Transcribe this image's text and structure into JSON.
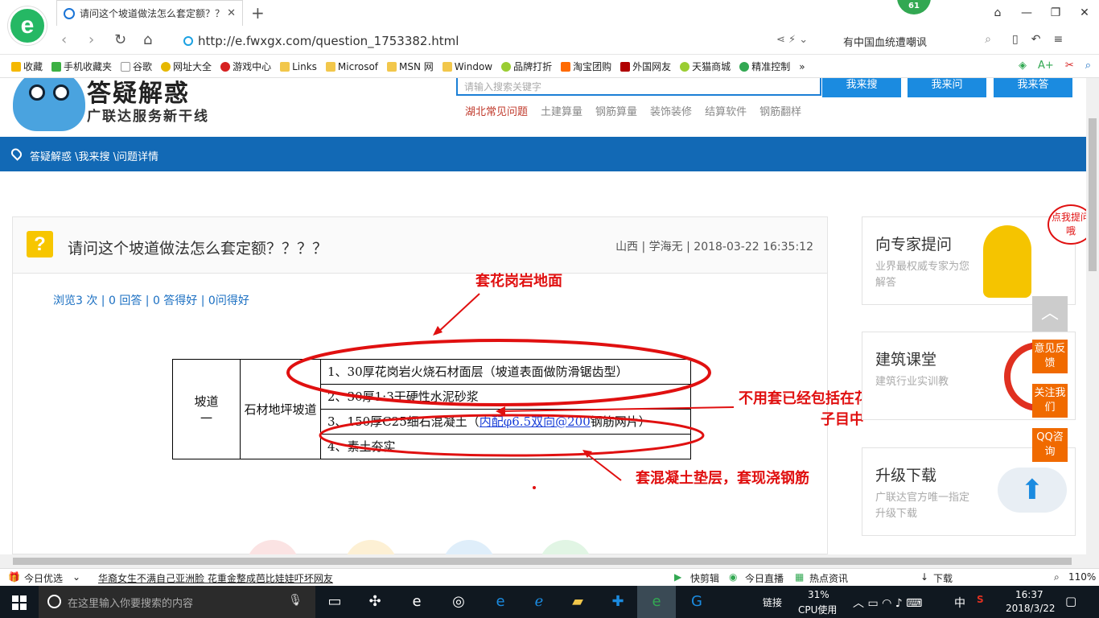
{
  "tab": {
    "title": "请问这个坡道做法怎么套定额？？？？",
    "badge": "61"
  },
  "address": {
    "url": "http://e.fwxgx.com/question_1753382.html",
    "search_text": "有中国血统遭嘲讽"
  },
  "bookmarks": [
    "收藏",
    "手机收藏夹",
    "谷歌",
    "网址大全",
    "游戏中心",
    "Links",
    "Microsof",
    "MSN 网",
    "Window",
    "品牌打折",
    "淘宝团购",
    "外国网友",
    "天猫商城",
    "精准控制"
  ],
  "site": {
    "logo_title": "答疑解惑",
    "logo_sub": "广联达服务新干线",
    "search_placeholder": "请输入搜索关键字",
    "btn_search": "我来搜",
    "btn_ask": "我来问",
    "btn_answer": "我来答",
    "tags": [
      "湖北常见问题",
      "土建算量",
      "钢筋算量",
      "装饰装修",
      "结算软件",
      "钢筋翻样"
    ],
    "breadcrumb": "答疑解惑 \\我来搜 \\问题详情"
  },
  "question": {
    "title": "请问这个坡道做法怎么套定额？？？？",
    "meta": "山西 | 学海无 | 2018-03-22 16:35:12",
    "stats": "浏览3 次 | 0 回答 | 0 答得好 | 0问得好"
  },
  "spec_table": {
    "col1": "坡道一",
    "col2": "石材地坪坡道",
    "line1": "1、30厚花岗岩火烧石材面层（坡道表面做防滑锯齿型）",
    "line2": "2、30厚1:3干硬性水泥砂浆",
    "line3_a": "3、150厚C25细石混凝土（",
    "line3_link": "内配φ6.5双向@200",
    "line3_b": "钢筋网片）",
    "line4": "4、素土夯实"
  },
  "annotations": {
    "a1": "套花岗岩地面",
    "a2_l1": "不用套已经包括在花岗岩",
    "a2_l2": "子目中",
    "a3": "套混凝土垫层，套现浇钢筋"
  },
  "sidebar": {
    "card1_title": "向专家提问",
    "card1_desc": "业界最权威专家为您解答",
    "card1_bubble": "点我提问哦",
    "card2_title": "建筑课堂",
    "card2_desc": "建筑行业实训教",
    "card3_title": "升级下载",
    "card3_desc": "广联达官方唯一指定升级下载",
    "float1": "意见反馈",
    "float2": "关注我们",
    "float3": "QQ咨询"
  },
  "statusbar": {
    "daily": "今日优选",
    "news": "华裔女生不满自己亚洲脸 花重金整成芭比娃娃吓坏网友",
    "kuaijian": "快剪辑",
    "live": "今日直播",
    "hot": "热点资讯",
    "download": "下载",
    "zoom": "110%"
  },
  "taskbar": {
    "search_placeholder": "在这里输入你要搜索的内容",
    "link": "链接",
    "cpu": "31%",
    "cpu_label": "CPU使用",
    "ime": "中",
    "time": "16:37",
    "date": "2018/3/22"
  },
  "colors": {
    "blue_bar": "#1269b5",
    "annotation_red": "#e01010",
    "accent_orange": "#f06a00"
  }
}
